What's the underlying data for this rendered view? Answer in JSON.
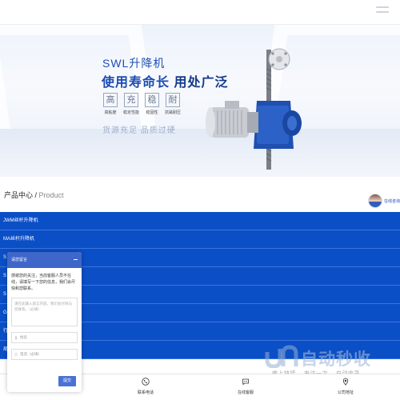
{
  "banner": {
    "title": "SWL升降机",
    "slogan_a": "使用寿命长",
    "slogan_b": " 用处广泛",
    "features": [
      {
        "char": "高",
        "label": "高粘度"
      },
      {
        "char": "充",
        "label": "稳定性能"
      },
      {
        "char": "稳",
        "label": "稳固性"
      },
      {
        "char": "耐",
        "label": "抗磁耐压"
      }
    ],
    "tagline": "货源充足  品质过硬"
  },
  "section": {
    "title_cn": "产品中心 / ",
    "title_en": "Product"
  },
  "consult": {
    "label": "在线咨询"
  },
  "products": [
    {
      "name": "JWM丝杆升降机"
    },
    {
      "name": "MA丝杆升降机"
    },
    {
      "name": "S"
    },
    {
      "name": "S"
    },
    {
      "name": "S"
    },
    {
      "name": "G"
    },
    {
      "name": "行"
    },
    {
      "name": "局"
    }
  ],
  "chat": {
    "header": "请您留言",
    "message": "感谢您的关注，当前客服人员不在线，请填写一下您的信息，我们会尽快和您联系。",
    "textarea_placeholder": "请在此输入留言内容，我们会尽快与您联系。（必填）",
    "name_placeholder": "姓名",
    "phone_placeholder": "电话（必填）",
    "send_label": "提交"
  },
  "bottom_nav": [
    {
      "label": "联系电话",
      "icon": "phone-icon"
    },
    {
      "label": "在线客服",
      "icon": "chat-icon"
    },
    {
      "label": "公司地址",
      "icon": "location-icon"
    }
  ],
  "watermark": {
    "title": "自动秒收录",
    "subtitle": "做上链接 →来访一次 →自动收录"
  },
  "colors": {
    "primary": "#0b4fc7",
    "chat_header": "#3f66c9",
    "banner_text": "#1f4fb5"
  }
}
